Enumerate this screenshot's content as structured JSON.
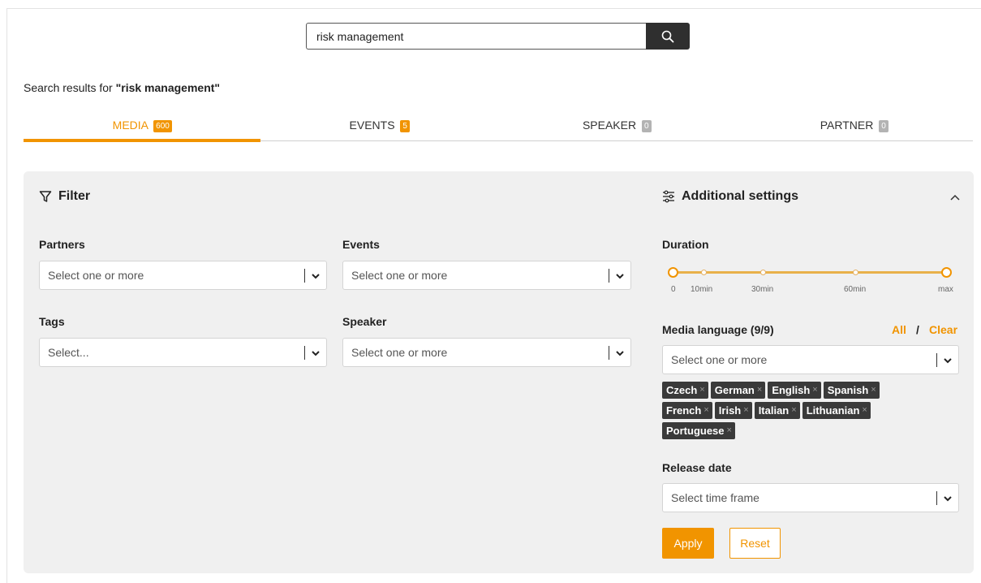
{
  "search": {
    "value": "risk management"
  },
  "results": {
    "prefix": "Search results for ",
    "query": "\"risk management\""
  },
  "tabs": [
    {
      "label": "MEDIA",
      "count": "600",
      "active": true
    },
    {
      "label": "EVENTS",
      "count": "5"
    },
    {
      "label": "SPEAKER",
      "count": "0"
    },
    {
      "label": "PARTNER",
      "count": "0"
    }
  ],
  "filter": {
    "title": "Filter",
    "partners": {
      "label": "Partners",
      "placeholder": "Select one or more"
    },
    "events": {
      "label": "Events",
      "placeholder": "Select one or more"
    },
    "tags": {
      "label": "Tags",
      "placeholder": "Select..."
    },
    "speaker": {
      "label": "Speaker",
      "placeholder": "Select one or more"
    }
  },
  "additional": {
    "title": "Additional settings",
    "duration": {
      "label": "Duration",
      "ticks": [
        "0",
        "10min",
        "30min",
        "60min",
        "max"
      ],
      "range": [
        "0",
        "max"
      ]
    },
    "media_language": {
      "label": "Media language (9/9)",
      "all": "All",
      "slash": "/",
      "clear": "Clear",
      "placeholder": "Select one or more",
      "selected": [
        "Czech",
        "German",
        "English",
        "Spanish",
        "French",
        "Irish",
        "Italian",
        "Lithuanian",
        "Portuguese"
      ]
    },
    "release_date": {
      "label": "Release date",
      "placeholder": "Select time frame"
    },
    "apply": "Apply",
    "reset": "Reset"
  },
  "colors": {
    "accent": "#f19400",
    "tag_bg": "#3a3a3a",
    "panel_bg": "#f0f0f0"
  }
}
